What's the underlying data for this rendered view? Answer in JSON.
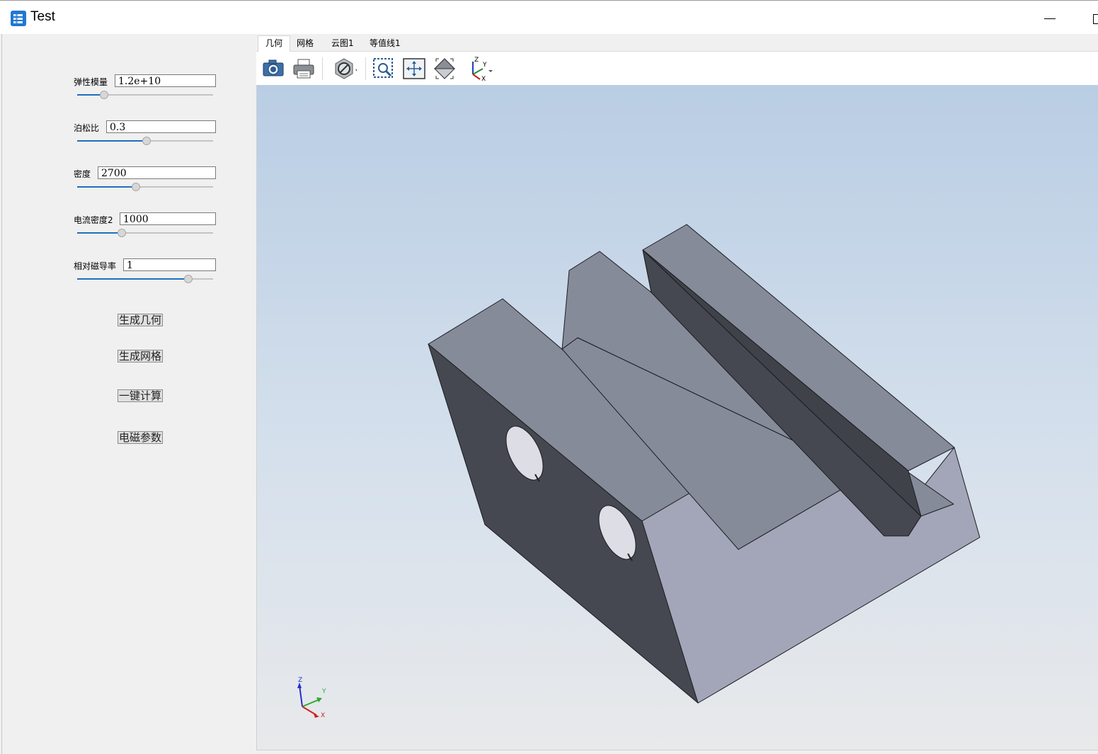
{
  "window": {
    "title": "Test",
    "icon": "app-icon"
  },
  "tabs": [
    {
      "label": "几何",
      "active": true
    },
    {
      "label": "网格",
      "active": false
    },
    {
      "label": "云图1",
      "active": false
    },
    {
      "label": "等值线1",
      "active": false
    }
  ],
  "toolbar": {
    "tools": [
      "camera-icon",
      "printer-icon",
      "section-icon",
      "zoom-box-icon",
      "fit-all-icon",
      "view-iso-icon",
      "axis-orient-icon"
    ]
  },
  "params": [
    {
      "label": "弹性模量",
      "value": "1.2e+10",
      "slider": 0.2
    },
    {
      "label": "泊松比",
      "value": "0.3",
      "slider": 0.51
    },
    {
      "label": "密度",
      "value": "2700",
      "slider": 0.43
    },
    {
      "label": "电流密度2",
      "value": "1000",
      "slider": 0.33
    },
    {
      "label": "相对磁导率",
      "value": "1",
      "slider": 0.82
    }
  ],
  "actions": {
    "generate_geometry": "生成几何",
    "generate_mesh": "生成网格",
    "compute_all": "一键计算",
    "em_params": "电磁参数"
  },
  "triad": {
    "x": "X",
    "y": "Y",
    "z": "Z"
  },
  "colors": {
    "accent": "#1e6fbf",
    "model_top": "#868b9a",
    "model_dark": "#454850",
    "model_light": "#a3a6b8"
  }
}
